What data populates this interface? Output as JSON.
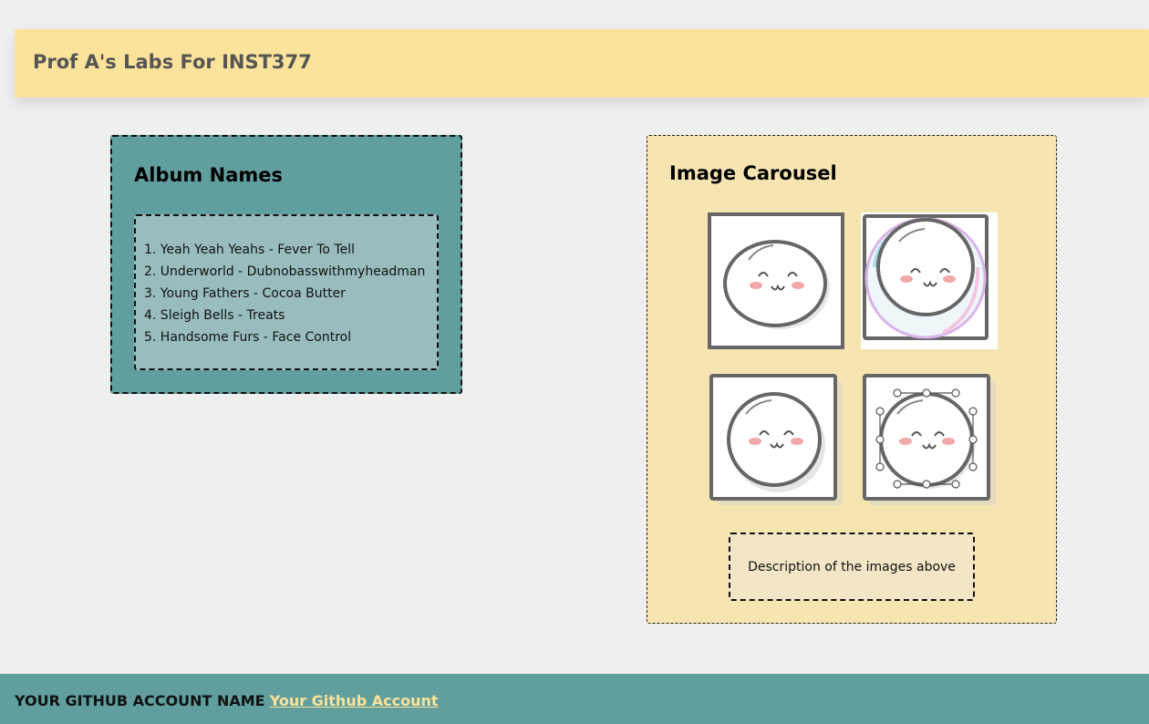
{
  "header": {
    "title": "Prof A's Labs For INST377"
  },
  "albums": {
    "heading": "Album Names",
    "items": [
      "1. Yeah Yeah Yeahs - Fever To Tell",
      "2. Underworld - Dubnobasswithmyheadman",
      "3. Young Fathers - Cocoa Butter",
      "4. Sleigh Bells - Treats",
      "5. Handsome Furs - Face Control"
    ]
  },
  "carousel": {
    "heading": "Image Carousel",
    "images": [
      {
        "icon": "smiley-face-icon"
      },
      {
        "icon": "smiley-bubble-icon"
      },
      {
        "icon": "smiley-face-icon"
      },
      {
        "icon": "smiley-vector-icon"
      }
    ],
    "caption": "Description of the images above"
  },
  "footer": {
    "label": "YOUR GITHUB ACCOUNT NAME",
    "link_text": "Your Github Account"
  },
  "colors": {
    "header_bg": "#fbe39b",
    "album_bg": "#619f9f",
    "album_list_bg": "#99bdbe",
    "carousel_bg": "#f6e5b1",
    "footer_bg": "#619f9f",
    "link": "#fbe39b"
  }
}
